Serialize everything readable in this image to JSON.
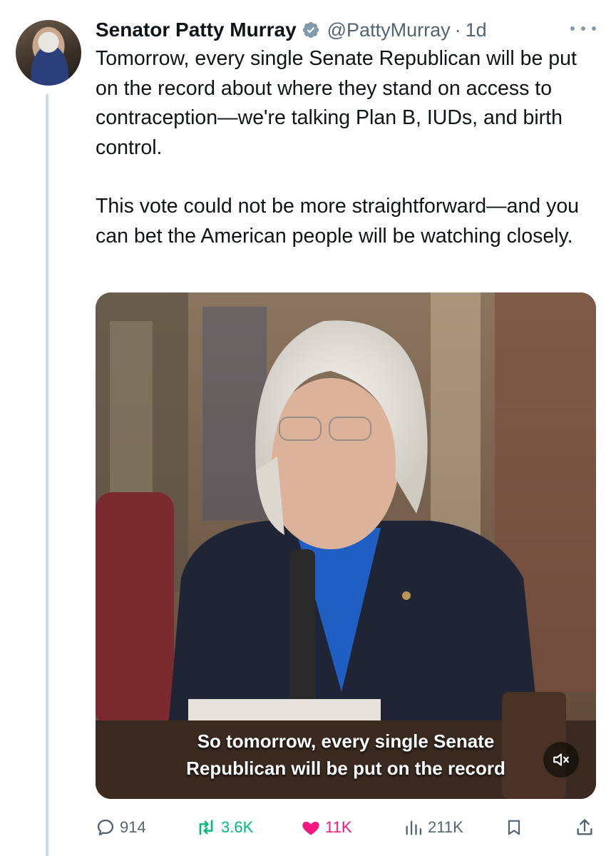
{
  "author": {
    "name": "Senator Patty Murray",
    "handle": "@PattyMurray",
    "separator": "·",
    "time": "1d"
  },
  "tweet": {
    "paragraphs": [
      "Tomorrow, every single Senate Republican will be put on the record about where they stand on access to contraception—we're talking Plan B, IUDs, and birth control.",
      "This vote could not be more straightforward—and you can bet the American people will be watching closely."
    ]
  },
  "video": {
    "caption_line1": "So tomorrow, every single Senate",
    "caption_line2": "Republican will be put on the record",
    "muted": true
  },
  "actions": {
    "replies": "914",
    "reposts": "3.6K",
    "likes": "11K",
    "views": "211K"
  },
  "colors": {
    "verified": "#829aab",
    "repost": "#00ba7c",
    "like": "#f91880",
    "muted_text": "#536471"
  },
  "icons": [
    "verified-badge-icon",
    "more-icon",
    "volume-muted-icon",
    "reply-icon",
    "repost-icon",
    "like-icon",
    "views-icon",
    "bookmark-icon",
    "share-icon"
  ]
}
